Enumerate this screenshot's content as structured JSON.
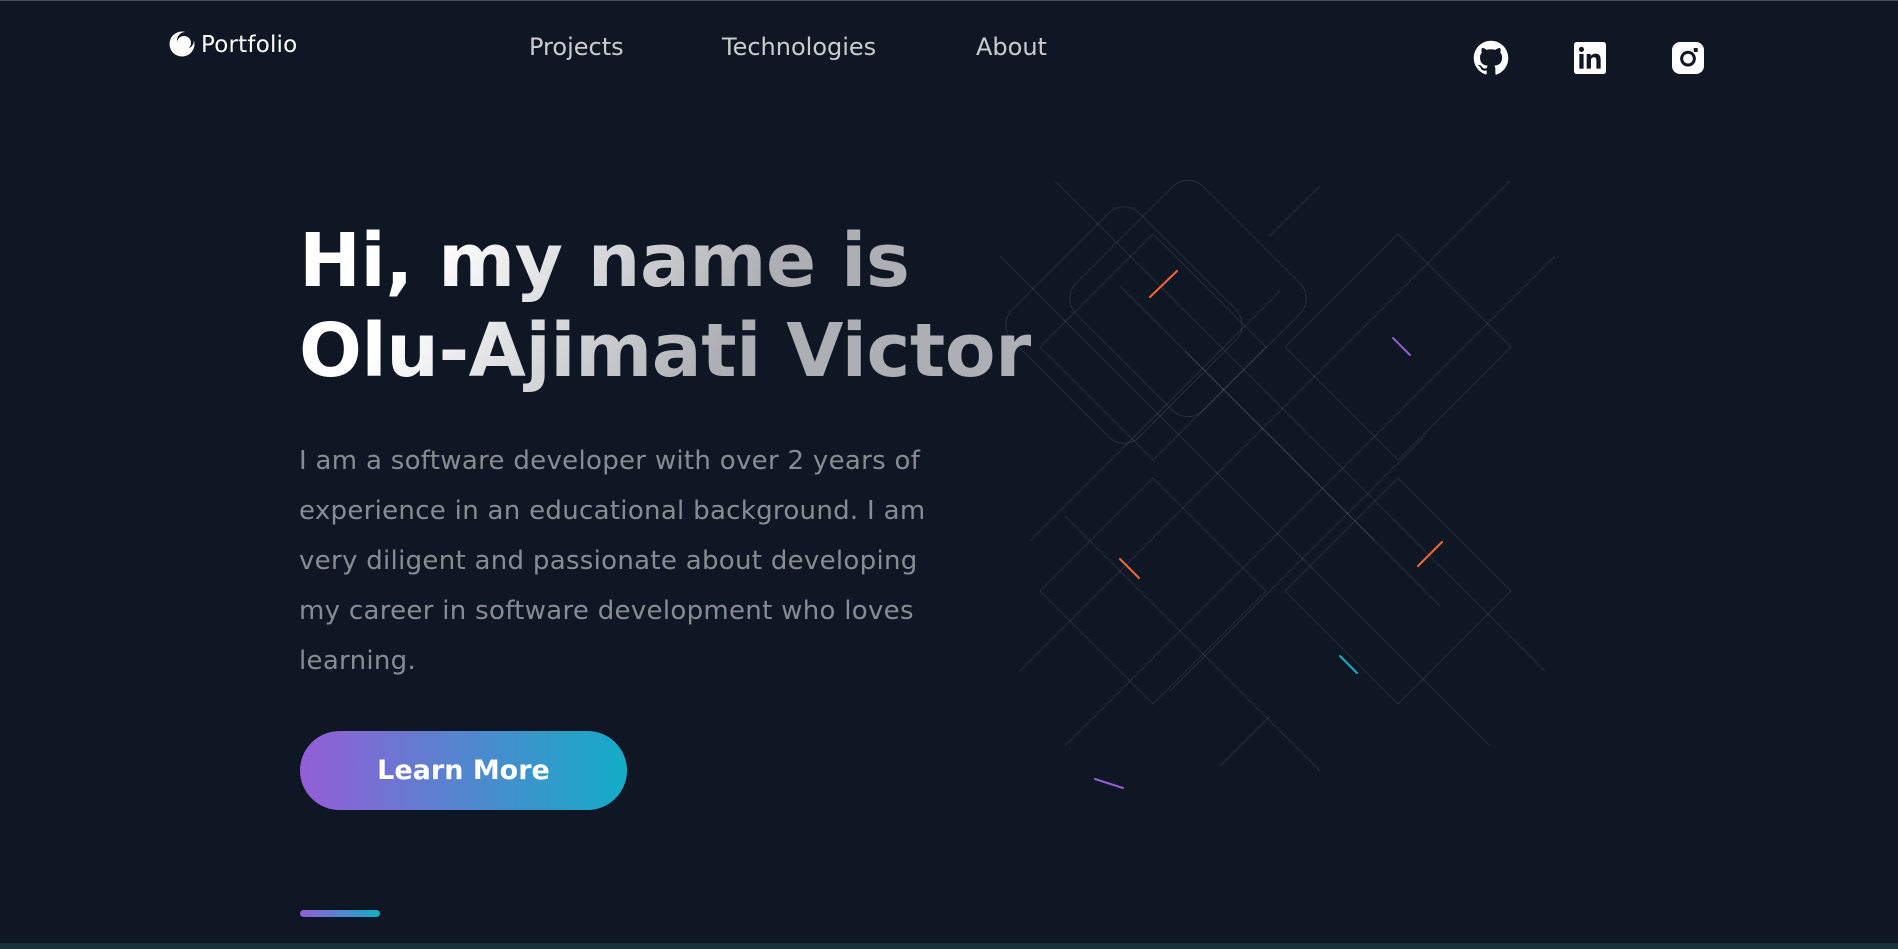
{
  "header": {
    "logo_text": "Portfolio",
    "nav": [
      "Projects",
      "Technologies",
      "About"
    ],
    "social_icons": [
      "github-icon",
      "linkedin-icon",
      "instagram-icon"
    ]
  },
  "hero": {
    "title_line1": "Hi, my name is",
    "title_line2": "Olu-Ajimati Victor",
    "text_lines": [
      "I am a software developer with over 2 years of",
      "experience in an educational background. I am",
      "very diligent and passionate about developing",
      "my career in software development who loves",
      "learning."
    ],
    "button_label": "Learn More"
  },
  "colors": {
    "background": "#0f1624",
    "gradient_start": "#945dd6",
    "gradient_mid": "#6978d1",
    "gradient_end": "#13adc7",
    "accent_orange": "#f46737"
  }
}
